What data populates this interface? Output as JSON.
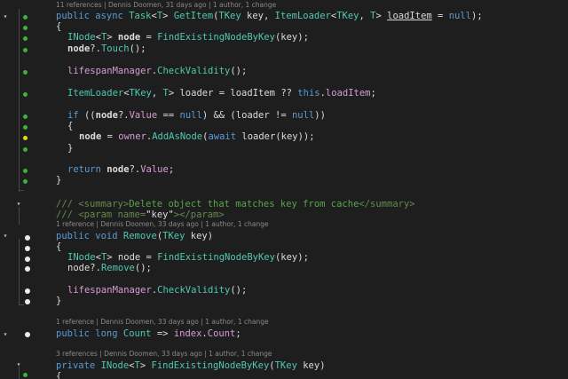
{
  "theme": {
    "background": "#1e1e1e",
    "coverage_green": "#3bb33b",
    "coverage_yellow": "#e0e000",
    "keyword": "#569cd6",
    "type": "#4ec9b0",
    "method": "#d69cd6",
    "comment": "#57a64a"
  },
  "code_lens": {
    "get_item": {
      "refs": "11 references",
      "author": "Dennis Doomen, 31 days ago",
      "authors": "1 author, 1 change"
    },
    "remove": {
      "refs": "1 reference",
      "author": "Dennis Doomen, 33 days ago",
      "authors": "1 author, 1 change"
    },
    "count": {
      "refs": "1 reference",
      "author": "Dennis Doomen, 33 days ago",
      "authors": "1 author, 1 change"
    },
    "find_node": {
      "refs": "3 references",
      "author": "Dennis Doomen, 33 days ago",
      "authors": "1 author, 1 change"
    }
  },
  "code": {
    "l1": {
      "public": "public",
      "async": "async",
      "task": "Task",
      "lt": "<",
      "t": "T",
      "gt": ">",
      "getitem": "GetItem",
      "p1": "(",
      "tkey": "TKey",
      "key": "key",
      "comma": ",",
      "itemloader": "ItemLoader",
      "lt2": "<",
      "tkey2": "TKey",
      "comma2": ",",
      "t2": "T",
      "gt2": ">",
      "loaditem": "loadItem",
      "eq": "=",
      "null": "null",
      "p2": ");"
    },
    "brace_open": "{",
    "brace_close": "}",
    "l3": {
      "inode": "INode",
      "lt": "<",
      "t": "T",
      "gt": ">",
      "node": "node",
      "eq": "=",
      "find": "FindExistingNodeByKey",
      "args": "(key);"
    },
    "l4": {
      "node": "node",
      "q": "?.",
      "touch": "Touch",
      "end": "();"
    },
    "l6": {
      "lm": "lifespanManager",
      "dot": ".",
      "check": "CheckValidity",
      "end": "();"
    },
    "l8": {
      "itemloader": "ItemLoader",
      "lt": "<",
      "tkey": "TKey",
      "comma": ",",
      "t": "T",
      "gt": ">",
      "loader": "loader",
      "eq": "=",
      "loaditem": "loadItem",
      "qq": "??",
      "this": "this",
      "dot": ".",
      "loaditem2": "loadItem",
      "end": ";"
    },
    "l10": {
      "if": "if",
      "open": "((",
      "node": "node",
      "q": "?.",
      "value": "Value",
      "eq": "==",
      "null": "null",
      "and": ") && (loader",
      "ne": "!=",
      "null2": "null",
      "end": "))"
    },
    "l12": {
      "node": "node",
      "eq": "=",
      "owner": "owner",
      "dot": ".",
      "add": "AddAsNode",
      "p": "(",
      "await": "await",
      "rest": "loader(key));"
    },
    "l15": {
      "return": "return",
      "node": "node",
      "q": "?.",
      "value": "Value",
      "end": ";"
    },
    "doc1": {
      "slashes": "///",
      "open": "<summary>",
      "text": "Delete object that matches key from cache",
      "close": "</summary>"
    },
    "doc2": {
      "slashes": "///",
      "open": "<param",
      "attr": "name=",
      "val": "\"key\"",
      "close": "></param>"
    },
    "l20": {
      "public": "public",
      "void": "void",
      "remove": "Remove",
      "p": "(",
      "tkey": "TKey",
      "key": "key",
      "end": ")"
    },
    "l22": {
      "inode": "INode",
      "lt": "<",
      "t": "T",
      "gt": ">",
      "node": "node",
      "eq": "=",
      "find": "FindExistingNodeByKey",
      "args": "(key);"
    },
    "l23": {
      "node": "node",
      "q": "?.",
      "remove": "Remove",
      "end": "();"
    },
    "l25": {
      "lm": "lifespanManager",
      "dot": ".",
      "check": "CheckValidity",
      "end": "();"
    },
    "l29": {
      "public": "public",
      "long": "long",
      "count": "Count",
      "arrow": "=>",
      "index": "index",
      "dot": ".",
      "count2": "Count",
      "end": ";"
    },
    "l31": {
      "private": "private",
      "inode": "INode",
      "lt": "<",
      "t": "T",
      "gt": ">",
      "find": "FindExistingNodeByKey",
      "p": "(",
      "tkey": "TKey",
      "key": "key",
      "end": ")"
    },
    "l32": {
      "brace": "{"
    }
  },
  "margin": {
    "collapse_icon": "chevron-down-icon",
    "coverage_marks": [
      "green",
      "green",
      "green",
      "green",
      "green",
      "green",
      "yellow",
      "green",
      "green",
      "white",
      "white",
      "white",
      "white",
      "white",
      "white",
      "white",
      "green"
    ]
  }
}
